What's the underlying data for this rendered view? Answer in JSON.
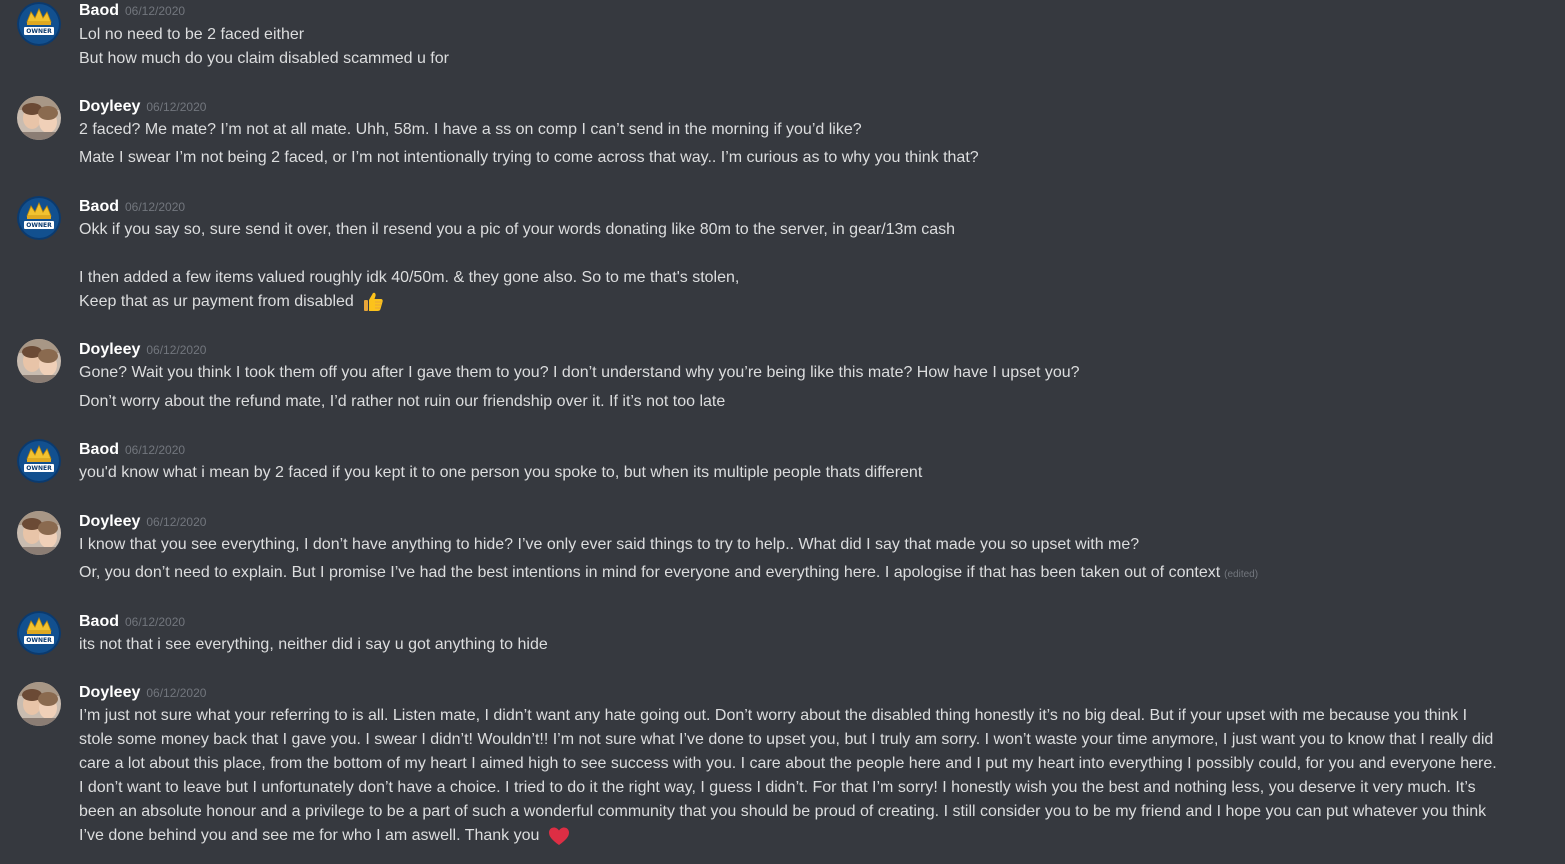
{
  "users": {
    "baod": {
      "name": "Baod",
      "avatar_icon": "owner-crown-avatar-icon",
      "avatar_bg": "#0b3a6e"
    },
    "doyleey": {
      "name": "Doyleey",
      "avatar_icon": "photo-avatar-icon",
      "avatar_bg": "#b8a89a"
    }
  },
  "avatar_badge_text": "OWNER",
  "timestamp": "06/12/2020",
  "messages": [
    {
      "author": "Baod",
      "time": "06/12/2020",
      "lines": [
        "Lol no need to be 2 faced either",
        "But how much do you claim disabled scammed u for"
      ]
    },
    {
      "author": "Doyleey",
      "time": "06/12/2020",
      "lines": [
        "2 faced? Me mate? I’m not at all mate. Uhh, 58m. I have a ss on comp I can’t send in the morning if you’d like?",
        "Mate I swear I’m not being 2 faced, or I’m not intentionally trying to come across that way.. I’m curious as to why you think that?"
      ]
    },
    {
      "author": "Baod",
      "time": "06/12/2020",
      "lines": [
        "Okk if you say so, sure send it over, then il resend you a pic of your words donating like 80m to the server, in gear/13m cash",
        "I then added a few items valued roughly idk 40/50m. & they gone also. So to me that's stolen,",
        "Keep that as ur payment from disabled"
      ],
      "emoji": "thumbs-up-icon"
    },
    {
      "author": "Doyleey",
      "time": "06/12/2020",
      "lines": [
        "Gone? Wait you think I took them off you after I gave them to you? I don’t understand why you’re being like this mate? How have I upset you?",
        "Don’t worry about the refund mate, I’d rather not ruin our friendship over it. If it’s not too late"
      ]
    },
    {
      "author": "Baod",
      "time": "06/12/2020",
      "lines": [
        "you'd know what i mean by 2 faced if you kept it to one person you spoke to, but when its multiple people thats different"
      ]
    },
    {
      "author": "Doyleey",
      "time": "06/12/2020",
      "lines": [
        "I know that you see everything, I don’t have anything to hide? I’ve only ever said things to try to help.. What did I say that made you so upset with me?",
        "Or, you don’t need to explain. But I promise I’ve had the best intentions in mind for everyone and everything here. I apologise if that has been taken out of context"
      ],
      "edited": "(edited)"
    },
    {
      "author": "Baod",
      "time": "06/12/2020",
      "lines": [
        "its not that i see everything, neither did i say u got anything to hide"
      ]
    },
    {
      "author": "Doyleey",
      "time": "06/12/2020",
      "lines": [
        "I’m just not sure what your referring to is all. Listen mate, I didn’t want any hate going out. Don’t worry about the disabled thing honestly it’s no big deal. But if your upset with me because you think I stole some money back that I gave you. I swear I didn’t! Wouldn’t!! I’m not sure what I’ve done to upset you, but I truly am sorry. I won’t waste your time anymore, I just want you to know that I really did care a lot about this place, from the bottom of my heart I aimed high to see success with you. I care about the people here and I put my heart into everything I possibly could, for you and everyone here. I don’t want to leave but I unfortunately don’t have a choice. I tried to do it the right way, I guess I didn’t. For that I’m sorry! I honestly wish you the best and nothing less, you deserve it very much. It’s been an absolute honour and a privilege to be a part of such a wonderful community that you should be proud of creating. I still consider you to be my friend and I hope you can put whatever you think I’ve done behind you and see me for who I am aswell. Thank you"
      ],
      "emoji": "red-heart-icon"
    }
  ],
  "colors": {
    "background": "#36393f",
    "text": "#dcddde",
    "username": "#ffffff",
    "muted": "#72767d"
  }
}
